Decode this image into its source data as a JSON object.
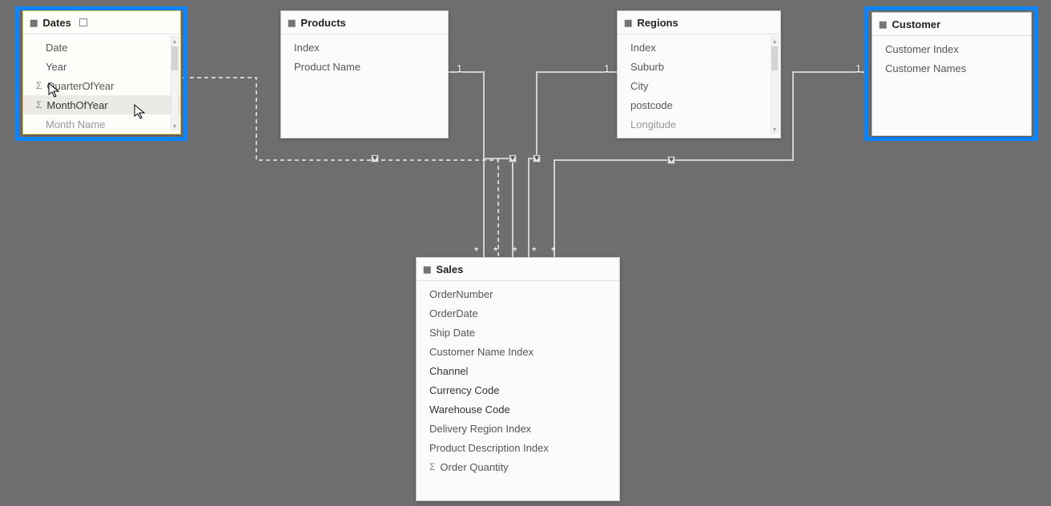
{
  "tables": {
    "dates": {
      "title": "Dates",
      "fields": [
        "Date",
        "Year",
        "QuarterOfYear",
        "MonthOfYear",
        "Month Name"
      ],
      "sigma_indices": [
        2,
        3
      ],
      "hovered_index": 3
    },
    "products": {
      "title": "Products",
      "fields": [
        "Index",
        "Product Name"
      ]
    },
    "regions": {
      "title": "Regions",
      "fields": [
        "Index",
        "Suburb",
        "City",
        "postcode",
        "Longitude"
      ]
    },
    "customer": {
      "title": "Customer",
      "fields": [
        "Customer Index",
        "Customer Names"
      ]
    },
    "sales": {
      "title": "Sales",
      "fields": [
        "OrderNumber",
        "OrderDate",
        "Ship Date",
        "Customer Name Index",
        "Channel",
        "Currency Code",
        "Warehouse Code",
        "Delivery Region Index",
        "Product Description Index",
        "Order Quantity"
      ],
      "sigma_indices": [
        9
      ]
    }
  },
  "cardinality": {
    "one": "1",
    "many": "*"
  }
}
